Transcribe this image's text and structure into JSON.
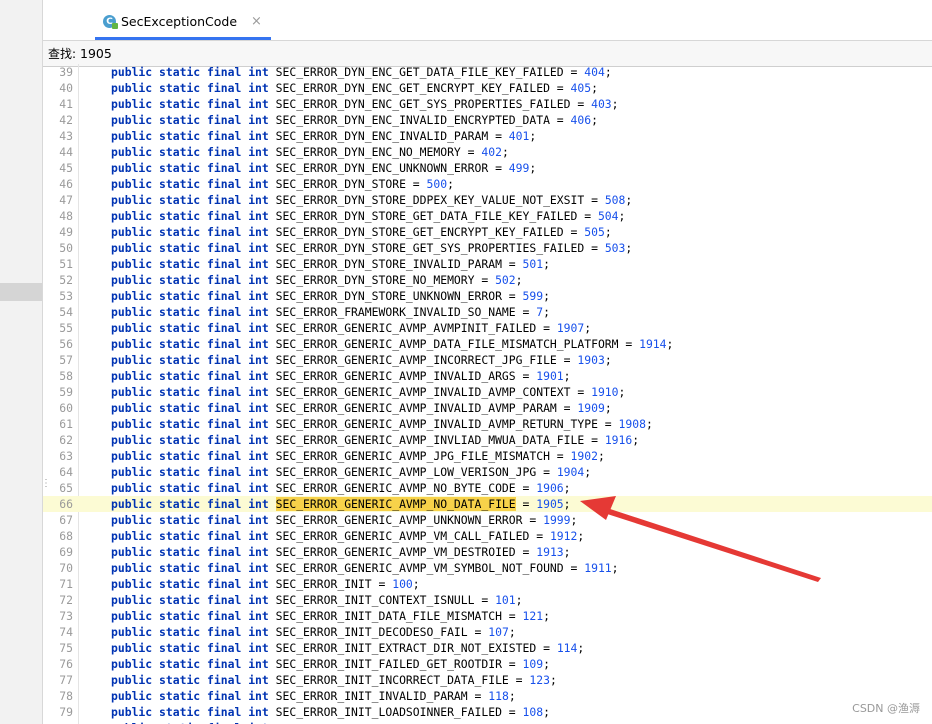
{
  "tab": {
    "title": "SecExceptionCode",
    "icon": "class-icon",
    "close": "×"
  },
  "find": {
    "label": "查找:",
    "value": "1905"
  },
  "editor": {
    "keywords": [
      "public",
      "static",
      "final",
      "int"
    ],
    "current_line": 66,
    "highlight_match": "SEC_ERROR_GENERIC_AVMP_NO_DATA_FILE",
    "lines": [
      {
        "n": "39",
        "name": "SEC_ERROR_DYN_ENC_GET_DATA_FILE_KEY_FAILED",
        "val": "404"
      },
      {
        "n": "40",
        "name": "SEC_ERROR_DYN_ENC_GET_ENCRYPT_KEY_FAILED",
        "val": "405"
      },
      {
        "n": "41",
        "name": "SEC_ERROR_DYN_ENC_GET_SYS_PROPERTIES_FAILED",
        "val": "403"
      },
      {
        "n": "42",
        "name": "SEC_ERROR_DYN_ENC_INVALID_ENCRYPTED_DATA",
        "val": "406"
      },
      {
        "n": "43",
        "name": "SEC_ERROR_DYN_ENC_INVALID_PARAM",
        "val": "401"
      },
      {
        "n": "44",
        "name": "SEC_ERROR_DYN_ENC_NO_MEMORY",
        "val": "402"
      },
      {
        "n": "45",
        "name": "SEC_ERROR_DYN_ENC_UNKNOWN_ERROR",
        "val": "499"
      },
      {
        "n": "46",
        "name": "SEC_ERROR_DYN_STORE",
        "val": "500"
      },
      {
        "n": "47",
        "name": "SEC_ERROR_DYN_STORE_DDPEX_KEY_VALUE_NOT_EXSIT",
        "val": "508"
      },
      {
        "n": "48",
        "name": "SEC_ERROR_DYN_STORE_GET_DATA_FILE_KEY_FAILED",
        "val": "504"
      },
      {
        "n": "49",
        "name": "SEC_ERROR_DYN_STORE_GET_ENCRYPT_KEY_FAILED",
        "val": "505"
      },
      {
        "n": "50",
        "name": "SEC_ERROR_DYN_STORE_GET_SYS_PROPERTIES_FAILED",
        "val": "503"
      },
      {
        "n": "51",
        "name": "SEC_ERROR_DYN_STORE_INVALID_PARAM",
        "val": "501"
      },
      {
        "n": "52",
        "name": "SEC_ERROR_DYN_STORE_NO_MEMORY",
        "val": "502"
      },
      {
        "n": "53",
        "name": "SEC_ERROR_DYN_STORE_UNKNOWN_ERROR",
        "val": "599"
      },
      {
        "n": "54",
        "name": "SEC_ERROR_FRAMEWORK_INVALID_SO_NAME",
        "val": "7"
      },
      {
        "n": "55",
        "name": "SEC_ERROR_GENERIC_AVMP_AVMPINIT_FAILED",
        "val": "1907"
      },
      {
        "n": "56",
        "name": "SEC_ERROR_GENERIC_AVMP_DATA_FILE_MISMATCH_PLATFORM",
        "val": "1914"
      },
      {
        "n": "57",
        "name": "SEC_ERROR_GENERIC_AVMP_INCORRECT_JPG_FILE",
        "val": "1903"
      },
      {
        "n": "58",
        "name": "SEC_ERROR_GENERIC_AVMP_INVALID_ARGS",
        "val": "1901"
      },
      {
        "n": "59",
        "name": "SEC_ERROR_GENERIC_AVMP_INVALID_AVMP_CONTEXT",
        "val": "1910"
      },
      {
        "n": "60",
        "name": "SEC_ERROR_GENERIC_AVMP_INVALID_AVMP_PARAM",
        "val": "1909"
      },
      {
        "n": "61",
        "name": "SEC_ERROR_GENERIC_AVMP_INVALID_AVMP_RETURN_TYPE",
        "val": "1908"
      },
      {
        "n": "62",
        "name": "SEC_ERROR_GENERIC_AVMP_INVLIAD_MWUA_DATA_FILE",
        "val": "1916"
      },
      {
        "n": "63",
        "name": "SEC_ERROR_GENERIC_AVMP_JPG_FILE_MISMATCH",
        "val": "1902"
      },
      {
        "n": "64",
        "name": "SEC_ERROR_GENERIC_AVMP_LOW_VERISON_JPG",
        "val": "1904"
      },
      {
        "n": "65",
        "name": "SEC_ERROR_GENERIC_AVMP_NO_BYTE_CODE",
        "val": "1906"
      },
      {
        "n": "66",
        "name": "SEC_ERROR_GENERIC_AVMP_NO_DATA_FILE",
        "val": "1905"
      },
      {
        "n": "67",
        "name": "SEC_ERROR_GENERIC_AVMP_UNKNOWN_ERROR",
        "val": "1999"
      },
      {
        "n": "68",
        "name": "SEC_ERROR_GENERIC_AVMP_VM_CALL_FAILED",
        "val": "1912"
      },
      {
        "n": "69",
        "name": "SEC_ERROR_GENERIC_AVMP_VM_DESTROIED",
        "val": "1913"
      },
      {
        "n": "70",
        "name": "SEC_ERROR_GENERIC_AVMP_VM_SYMBOL_NOT_FOUND",
        "val": "1911"
      },
      {
        "n": "71",
        "name": "SEC_ERROR_INIT",
        "val": "100"
      },
      {
        "n": "72",
        "name": "SEC_ERROR_INIT_CONTEXT_ISNULL",
        "val": "101"
      },
      {
        "n": "73",
        "name": "SEC_ERROR_INIT_DATA_FILE_MISMATCH",
        "val": "121"
      },
      {
        "n": "74",
        "name": "SEC_ERROR_INIT_DECODESO_FAIL",
        "val": "107"
      },
      {
        "n": "75",
        "name": "SEC_ERROR_INIT_EXTRACT_DIR_NOT_EXISTED",
        "val": "114"
      },
      {
        "n": "76",
        "name": "SEC_ERROR_INIT_FAILED_GET_ROOTDIR",
        "val": "109"
      },
      {
        "n": "77",
        "name": "SEC_ERROR_INIT_INCORRECT_DATA_FILE",
        "val": "123"
      },
      {
        "n": "78",
        "name": "SEC_ERROR_INIT_INVALID_PARAM",
        "val": "118"
      },
      {
        "n": "79",
        "name": "SEC_ERROR_INIT_LOADSOINNER_FAILED",
        "val": "108"
      },
      {
        "n": "",
        "name": "",
        "val": ""
      }
    ]
  },
  "watermark": "CSDN @渔溽",
  "colors": {
    "keyword": "#0033b3",
    "number": "#1750eb",
    "match_highlight": "#f7d24a",
    "arrow": "#e53935",
    "tab_underline": "#3574f0"
  }
}
